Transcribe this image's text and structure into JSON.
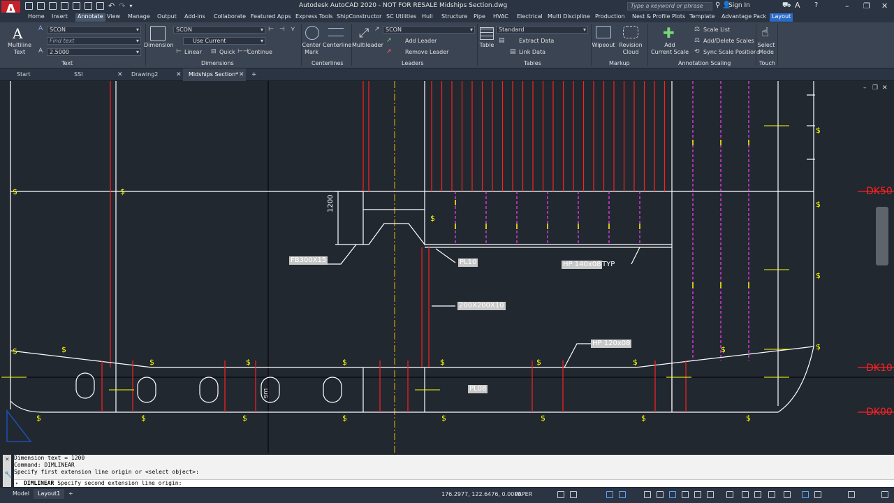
{
  "app": {
    "logo": "A",
    "title": "Autodesk AutoCAD 2020 - NOT FOR RESALE    Midships Section.dwg",
    "search_placeholder": "Type a keyword or phrase",
    "signin": "Sign In"
  },
  "ribbon_tabs": [
    "Home",
    "Insert",
    "Annotate",
    "View",
    "Manage",
    "Output",
    "Add-ins",
    "Collaborate",
    "Featured Apps",
    "Express Tools",
    "ShipConstructor",
    "SC Utilities",
    "Hull",
    "Structure",
    "Pipe",
    "HVAC",
    "Electrical",
    "Multi Discipline",
    "Production",
    "Nest & Profile Plots",
    "Template",
    "Advantage Pack",
    "Layout"
  ],
  "active_tab": "Annotate",
  "ribbon": {
    "text_panel": {
      "label": "Text",
      "multiline_text": "Multiline\nText",
      "style_value": "SCON",
      "find_placeholder": "Find text",
      "height_value": "2.5000"
    },
    "dimensions_panel": {
      "label": "Dimensions",
      "dimension": "Dimension",
      "style_value": "SCON",
      "layer_value": "Use Current",
      "linear": "Linear",
      "quick": "Quick",
      "continue": "Continue"
    },
    "centerlines_panel": {
      "label": "Centerlines",
      "center_mark": "Center\nMark",
      "centerline": "Centerline"
    },
    "leaders_panel": {
      "label": "Leaders",
      "multileader": "Multileader",
      "style_value": "SCON",
      "add_leader": "Add Leader",
      "remove_leader": "Remove Leader"
    },
    "tables_panel": {
      "label": "Tables",
      "table": "Table",
      "style_value": "Standard",
      "extract_data": "Extract Data",
      "link_data": "Link Data"
    },
    "markup_panel": {
      "label": "Markup",
      "wipeout": "Wipeout",
      "revision_cloud": "Revision\nCloud"
    },
    "annotation_scaling_panel": {
      "label": "Annotation Scaling",
      "add_current_scale": "Add\nCurrent Scale",
      "scale_list": "Scale List",
      "add_delete_scales": "Add/Delete Scales",
      "sync_scale_positions": "Sync Scale Positions"
    },
    "touch_panel": {
      "label": "Touch",
      "select_mode": "Select\nMode"
    }
  },
  "file_tabs": [
    {
      "label": "Start",
      "closable": false
    },
    {
      "label": "SSI",
      "closable": true
    },
    {
      "label": "Drawing2",
      "closable": true
    },
    {
      "label": "Midships Section*",
      "closable": true
    }
  ],
  "active_file_tab": "Midships Section*",
  "drawing": {
    "deck_labels": [
      "DK50",
      "DK10",
      "DK00"
    ],
    "dimension_text": "1200",
    "annotations": {
      "fb": "FB300X15",
      "pl10": "PL10",
      "hp140": "HP 140x08",
      "hp140_suffix": "TYP",
      "box": "200X200X10",
      "hp120": "HP 120x08",
      "pl08": "PL08",
      "lug": "LUG"
    },
    "colors": {
      "background": "#212830",
      "hull_lines": "#ffffff",
      "red_members": "#ff2020",
      "yellow_marks": "#ffff00",
      "magenta_dashed": "#ff3cff",
      "centerline": "#d4a000"
    }
  },
  "command_line": {
    "history": [
      "Dimension text = 1200",
      "Command: DIMLINEAR",
      "Specify first extension line origin or <select object>:"
    ],
    "prompt_command": "DIMLINEAR",
    "prompt_text": "Specify second extension line origin:"
  },
  "status_bar": {
    "layout_tabs": [
      "Model",
      "Layout1"
    ],
    "active_layout": "Layout1",
    "add_tab": "+",
    "coordinates": "176.2977, 122.6476, 0.0000",
    "space": "PAPER"
  }
}
